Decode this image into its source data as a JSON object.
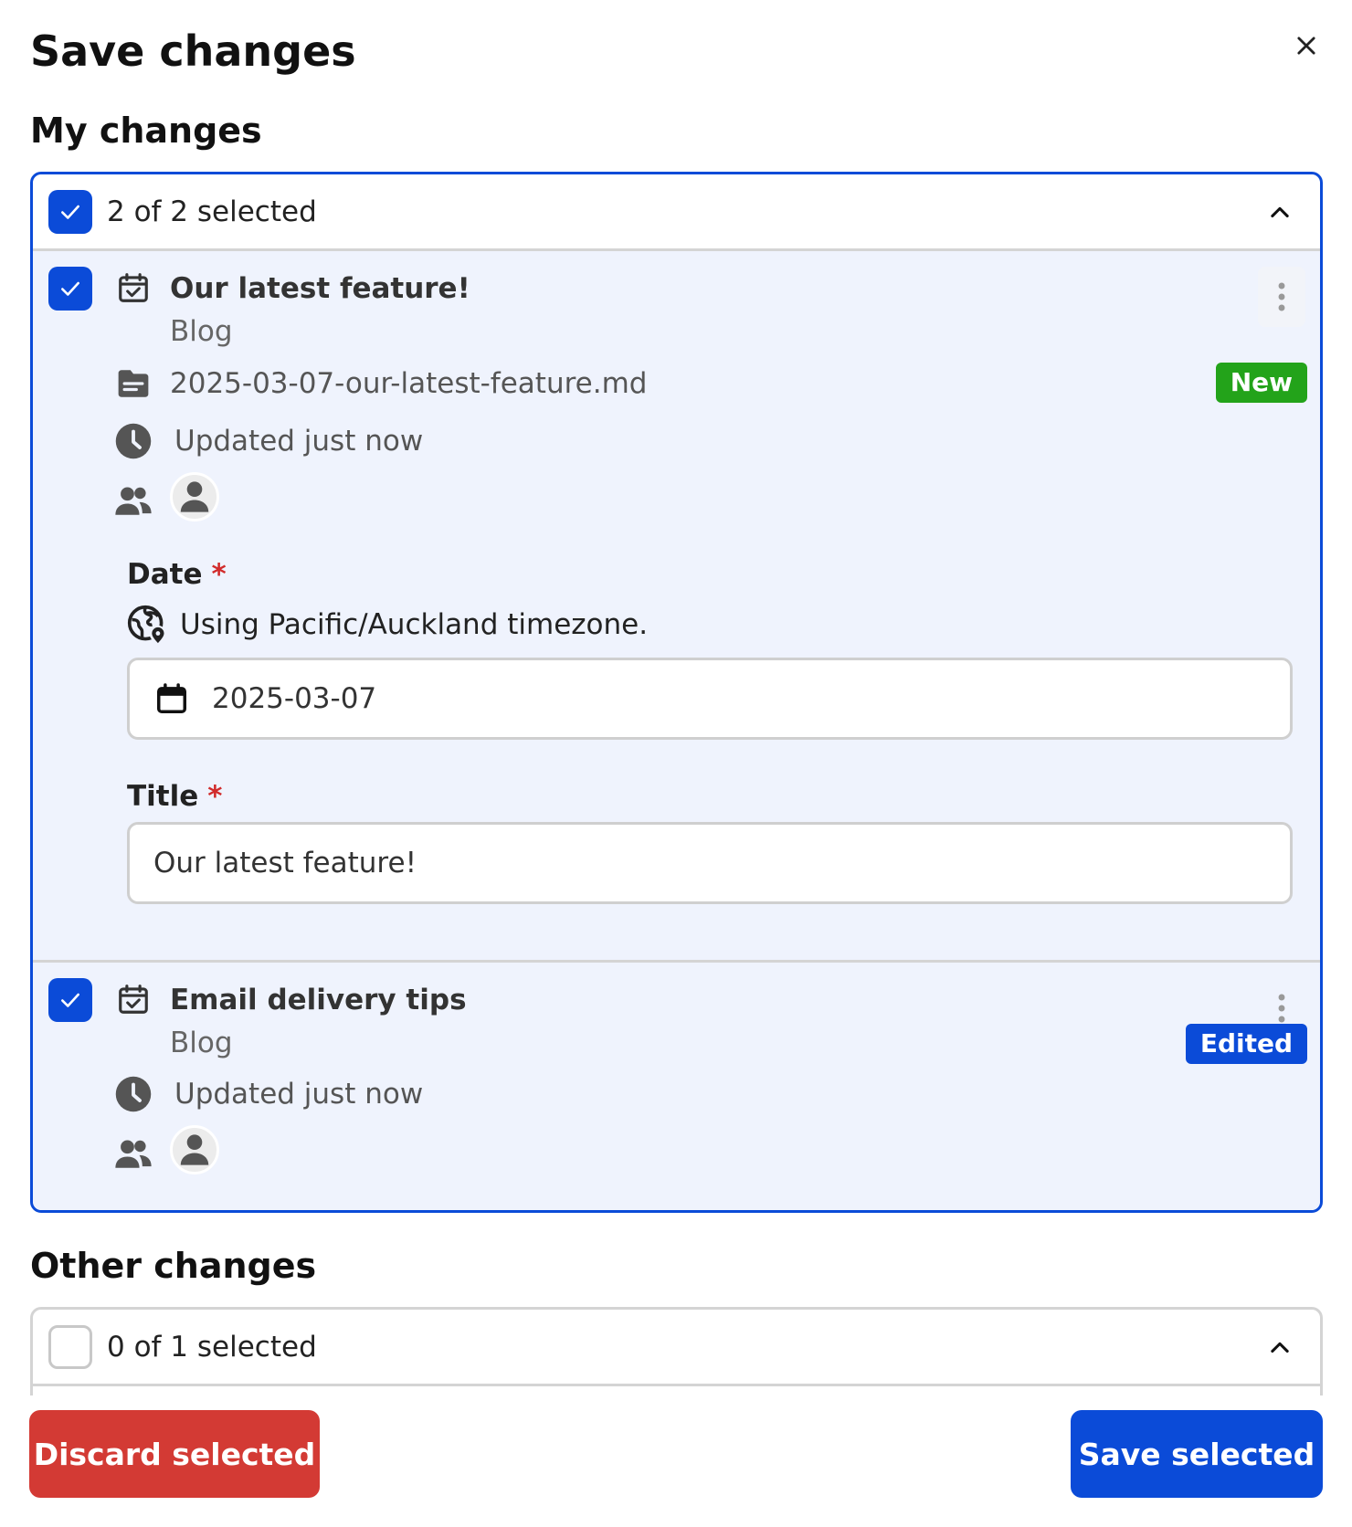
{
  "dialog": {
    "title": "Save changes"
  },
  "my_changes": {
    "heading": "My changes",
    "selection": "2 of 2 selected",
    "items": [
      {
        "title": "Our latest feature!",
        "collection": "Blog",
        "filename": "2025-03-07-our-latest-feature.md",
        "badge": "New",
        "updated": "Updated just now",
        "fields": {
          "date_label": "Date",
          "required_mark": "*",
          "timezone_note": "Using Pacific/Auckland timezone.",
          "date_value": "2025-03-07",
          "title_label": "Title",
          "title_value": "Our latest feature!"
        }
      },
      {
        "title": "Email delivery tips",
        "collection": "Blog",
        "badge": "Edited",
        "updated": "Updated just now"
      }
    ]
  },
  "other_changes": {
    "heading": "Other changes",
    "selection": "0 of 1 selected"
  },
  "footer": {
    "discard_label": "Discard selected",
    "save_label": "Save selected"
  },
  "colors": {
    "primary": "#0b4bd8",
    "danger": "#d33a34",
    "success": "#23a31a",
    "item_bg": "#eff3fd"
  }
}
